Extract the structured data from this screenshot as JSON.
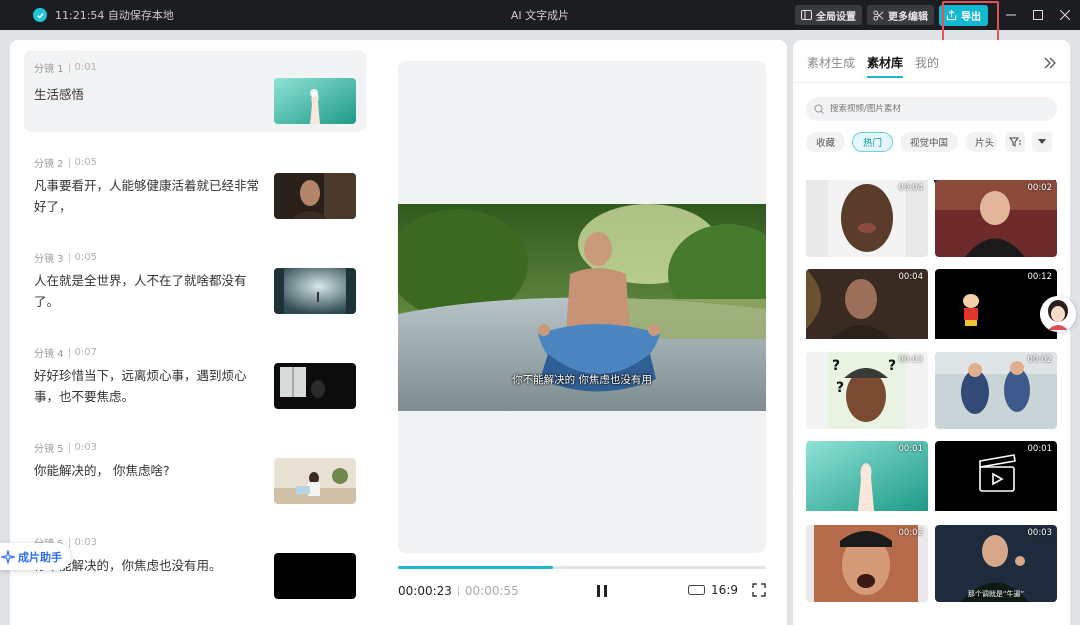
{
  "titlebar": {
    "status": "11:21:54 自动保存本地",
    "title": "AI 文字成片",
    "global_settings": "全局设置",
    "more_edit": "更多编辑",
    "export": "导出"
  },
  "scenes": [
    {
      "label": "分镜 1",
      "duration": "0:01",
      "text": "生活感悟"
    },
    {
      "label": "分镜 2",
      "duration": "0:05",
      "text": "凡事要看开，人能够健康活着就已经非常好了，"
    },
    {
      "label": "分镜 3",
      "duration": "0:05",
      "text": "人在就是全世界，人不在了就啥都没有了。"
    },
    {
      "label": "分镜 4",
      "duration": "0:07",
      "text": "好好珍惜当下，远离烦心事，遇到烦心事，也不要焦虑。"
    },
    {
      "label": "分镜 5",
      "duration": "0:03",
      "text": "你能解决的， 你焦虑啥?"
    },
    {
      "label": "分镜 6",
      "duration": "0:03",
      "text": "你不能解决的，你焦虑也没有用。"
    }
  ],
  "helper": {
    "label": "成片助手"
  },
  "player": {
    "subtitle": "你不能解决的 你焦虑也没有用",
    "current_time": "00:00:23",
    "total_time": "00:00:55",
    "progress": 0.42,
    "ratio": "16:9"
  },
  "side": {
    "tabs": [
      "素材生成",
      "素材库",
      "我的"
    ],
    "active_tab": "素材库",
    "search_placeholder": "搜索视频/图片素材",
    "chips": [
      "收藏",
      "热门",
      "视觉中国",
      "片头"
    ],
    "active_chip": "热门",
    "assets": [
      {
        "duration": "00:04",
        "icon": "man-crying"
      },
      {
        "duration": "00:02",
        "icon": "comedian-on-stage"
      },
      {
        "duration": "00:04",
        "icon": "ancient-warrior"
      },
      {
        "duration": "00:12",
        "icon": "cartoon-boy"
      },
      {
        "duration": "00:03",
        "icon": "confused-man"
      },
      {
        "duration": "00:02",
        "icon": "police-office"
      },
      {
        "duration": "00:01",
        "icon": "hand-gesture"
      },
      {
        "duration": "00:01",
        "icon": "clapperboard"
      },
      {
        "duration": "00:02",
        "icon": "shocked-man"
      },
      {
        "duration": "00:03",
        "icon": "man-gesture-caption"
      }
    ],
    "asset_captions": {
      "comedian": "",
      "gesture": "那个调就是“牛逼”"
    }
  },
  "colors": {
    "accent": "#1db8d0",
    "titlebar": "#1c1d21",
    "export": "#15b8cf",
    "highlight_frame": "#e4535c"
  }
}
